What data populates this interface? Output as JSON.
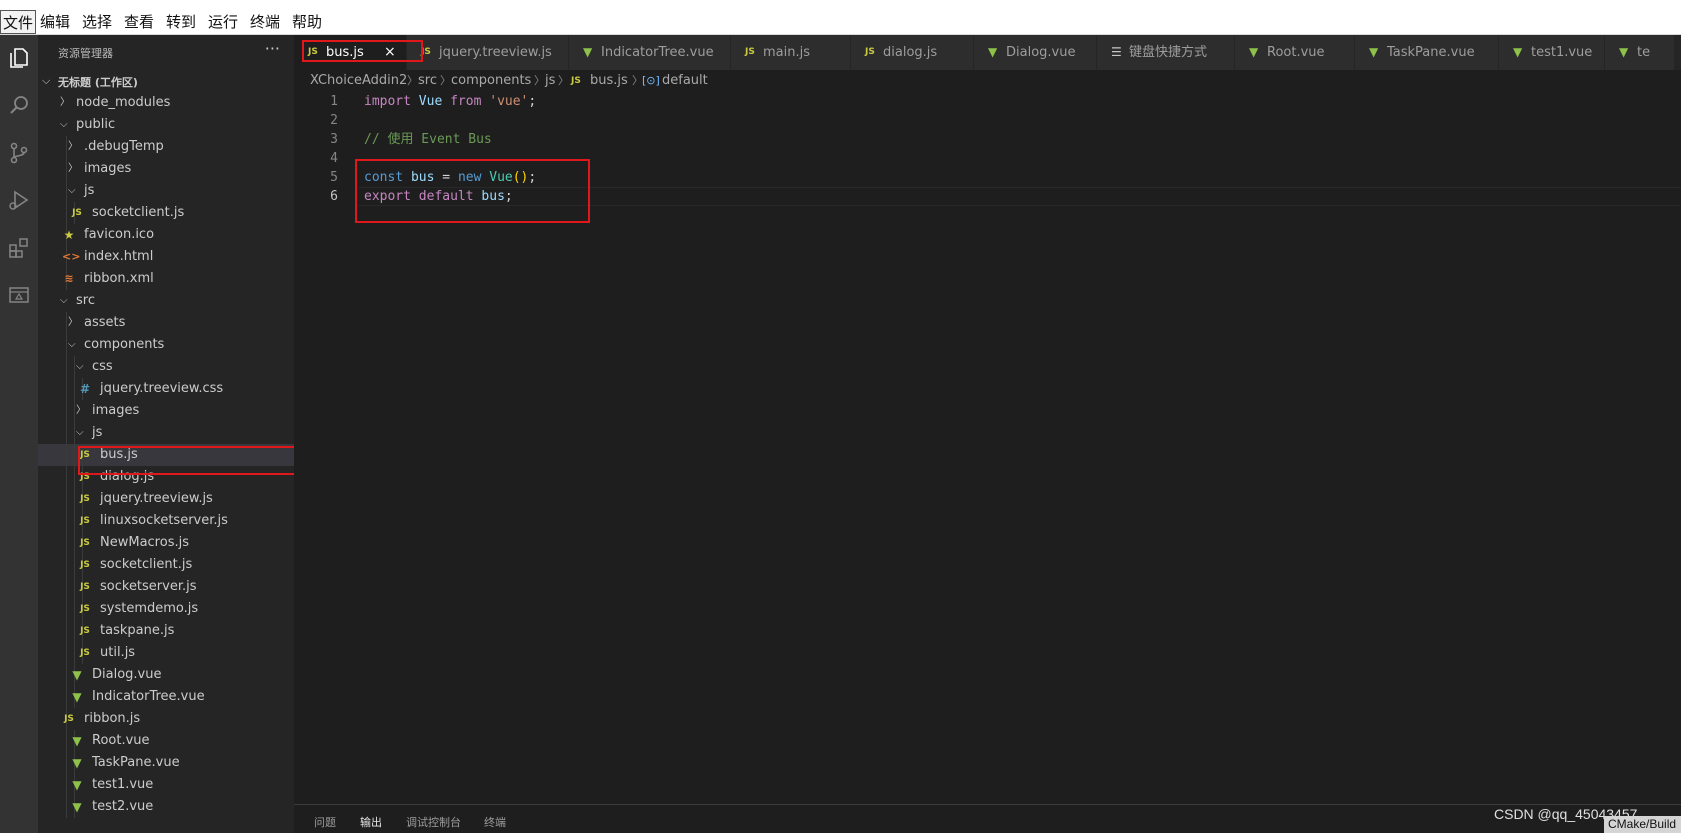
{
  "menu": [
    "文件",
    "编辑",
    "选择",
    "查看",
    "转到",
    "运行",
    "终端",
    "帮助"
  ],
  "activity_icons": [
    "explorer-icon",
    "search-icon",
    "source-control-icon",
    "run-debug-icon",
    "extensions-icon",
    "remote-explorer-icon"
  ],
  "sidebar": {
    "title": "资源管理器",
    "more": "···",
    "workspace": "无标题 (工作区)",
    "tree": [
      {
        "label": "node_modules",
        "depth": 0,
        "type": "folder",
        "open": false
      },
      {
        "label": "public",
        "depth": 0,
        "type": "folder",
        "open": true
      },
      {
        "label": ".debugTemp",
        "depth": 1,
        "type": "folder",
        "open": false
      },
      {
        "label": "images",
        "depth": 1,
        "type": "folder",
        "open": false
      },
      {
        "label": "js",
        "depth": 1,
        "type": "folder",
        "open": true
      },
      {
        "label": "socketclient.js",
        "depth": 2,
        "type": "js"
      },
      {
        "label": "favicon.ico",
        "depth": 1,
        "type": "fav"
      },
      {
        "label": "index.html",
        "depth": 1,
        "type": "html"
      },
      {
        "label": "ribbon.xml",
        "depth": 1,
        "type": "xml"
      },
      {
        "label": "src",
        "depth": 0,
        "type": "folder",
        "open": true
      },
      {
        "label": "assets",
        "depth": 1,
        "type": "folder",
        "open": false
      },
      {
        "label": "components",
        "depth": 1,
        "type": "folder",
        "open": true
      },
      {
        "label": "css",
        "depth": 2,
        "type": "folder",
        "open": true
      },
      {
        "label": "jquery.treeview.css",
        "depth": 3,
        "type": "css"
      },
      {
        "label": "images",
        "depth": 2,
        "type": "folder",
        "open": false
      },
      {
        "label": "js",
        "depth": 2,
        "type": "folder",
        "open": true
      },
      {
        "label": "bus.js",
        "depth": 3,
        "type": "js",
        "selected": true
      },
      {
        "label": "dialog.js",
        "depth": 3,
        "type": "js"
      },
      {
        "label": "jquery.treeview.js",
        "depth": 3,
        "type": "js"
      },
      {
        "label": "linuxsocketserver.js",
        "depth": 3,
        "type": "js"
      },
      {
        "label": "NewMacros.js",
        "depth": 3,
        "type": "js"
      },
      {
        "label": "socketclient.js",
        "depth": 3,
        "type": "js"
      },
      {
        "label": "socketserver.js",
        "depth": 3,
        "type": "js"
      },
      {
        "label": "systemdemo.js",
        "depth": 3,
        "type": "js"
      },
      {
        "label": "taskpane.js",
        "depth": 3,
        "type": "js"
      },
      {
        "label": "util.js",
        "depth": 3,
        "type": "js"
      },
      {
        "label": "Dialog.vue",
        "depth": 2,
        "type": "vue"
      },
      {
        "label": "IndicatorTree.vue",
        "depth": 2,
        "type": "vue"
      },
      {
        "label": "ribbon.js",
        "depth": 1,
        "type": "js"
      },
      {
        "label": "Root.vue",
        "depth": 2,
        "type": "vue"
      },
      {
        "label": "TaskPane.vue",
        "depth": 2,
        "type": "vue"
      },
      {
        "label": "test1.vue",
        "depth": 2,
        "type": "vue"
      },
      {
        "label": "test2.vue",
        "depth": 2,
        "type": "vue"
      }
    ]
  },
  "tabs": [
    {
      "label": "bus.js",
      "type": "js",
      "active": true,
      "close": "×"
    },
    {
      "label": "jquery.treeview.js",
      "type": "js"
    },
    {
      "label": "IndicatorTree.vue",
      "type": "vue"
    },
    {
      "label": "main.js",
      "type": "js"
    },
    {
      "label": "dialog.js",
      "type": "js"
    },
    {
      "label": "Dialog.vue",
      "type": "vue"
    },
    {
      "label": "键盘快捷方式",
      "type": "kb"
    },
    {
      "label": "Root.vue",
      "type": "vue"
    },
    {
      "label": "TaskPane.vue",
      "type": "vue"
    },
    {
      "label": "test1.vue",
      "type": "vue"
    },
    {
      "label": "te",
      "type": "vue"
    }
  ],
  "breadcrumb": [
    "XChoiceAddin2",
    "src",
    "components",
    "js",
    "bus.js",
    "default"
  ],
  "editor": {
    "line_numbers": [
      "1",
      "2",
      "3",
      "4",
      "5",
      "6"
    ],
    "current_line": "6",
    "code": [
      [
        {
          "t": "import ",
          "c": "kw-purple"
        },
        {
          "t": "Vue ",
          "c": "var"
        },
        {
          "t": "from ",
          "c": "kw-purple"
        },
        {
          "t": "'vue'",
          "c": "str"
        },
        {
          "t": ";",
          "c": ""
        }
      ],
      [],
      [
        {
          "t": "// 使用 Event Bus",
          "c": "cmt"
        }
      ],
      [],
      [
        {
          "t": "const ",
          "c": "kw-blue"
        },
        {
          "t": "bus",
          "c": "var"
        },
        {
          "t": " = ",
          "c": ""
        },
        {
          "t": "new ",
          "c": "kw-blue"
        },
        {
          "t": "Vue",
          "c": "cls"
        },
        {
          "t": "()",
          "c": "paren"
        },
        {
          "t": ";",
          "c": ""
        }
      ],
      [
        {
          "t": "export ",
          "c": "kw-purple"
        },
        {
          "t": "default ",
          "c": "kw-purple"
        },
        {
          "t": "bus",
          "c": "var"
        },
        {
          "t": ";",
          "c": ""
        }
      ]
    ]
  },
  "panel": {
    "tabs": [
      "问题",
      "输出",
      "调试控制台",
      "终端"
    ],
    "active": "输出"
  },
  "watermark": "CSDN @qq_45043457",
  "status_fragment": "CMake/Build",
  "colors": {
    "accent_red": "#e0181b",
    "js": "#cbcb41",
    "vue": "#8dc149"
  }
}
